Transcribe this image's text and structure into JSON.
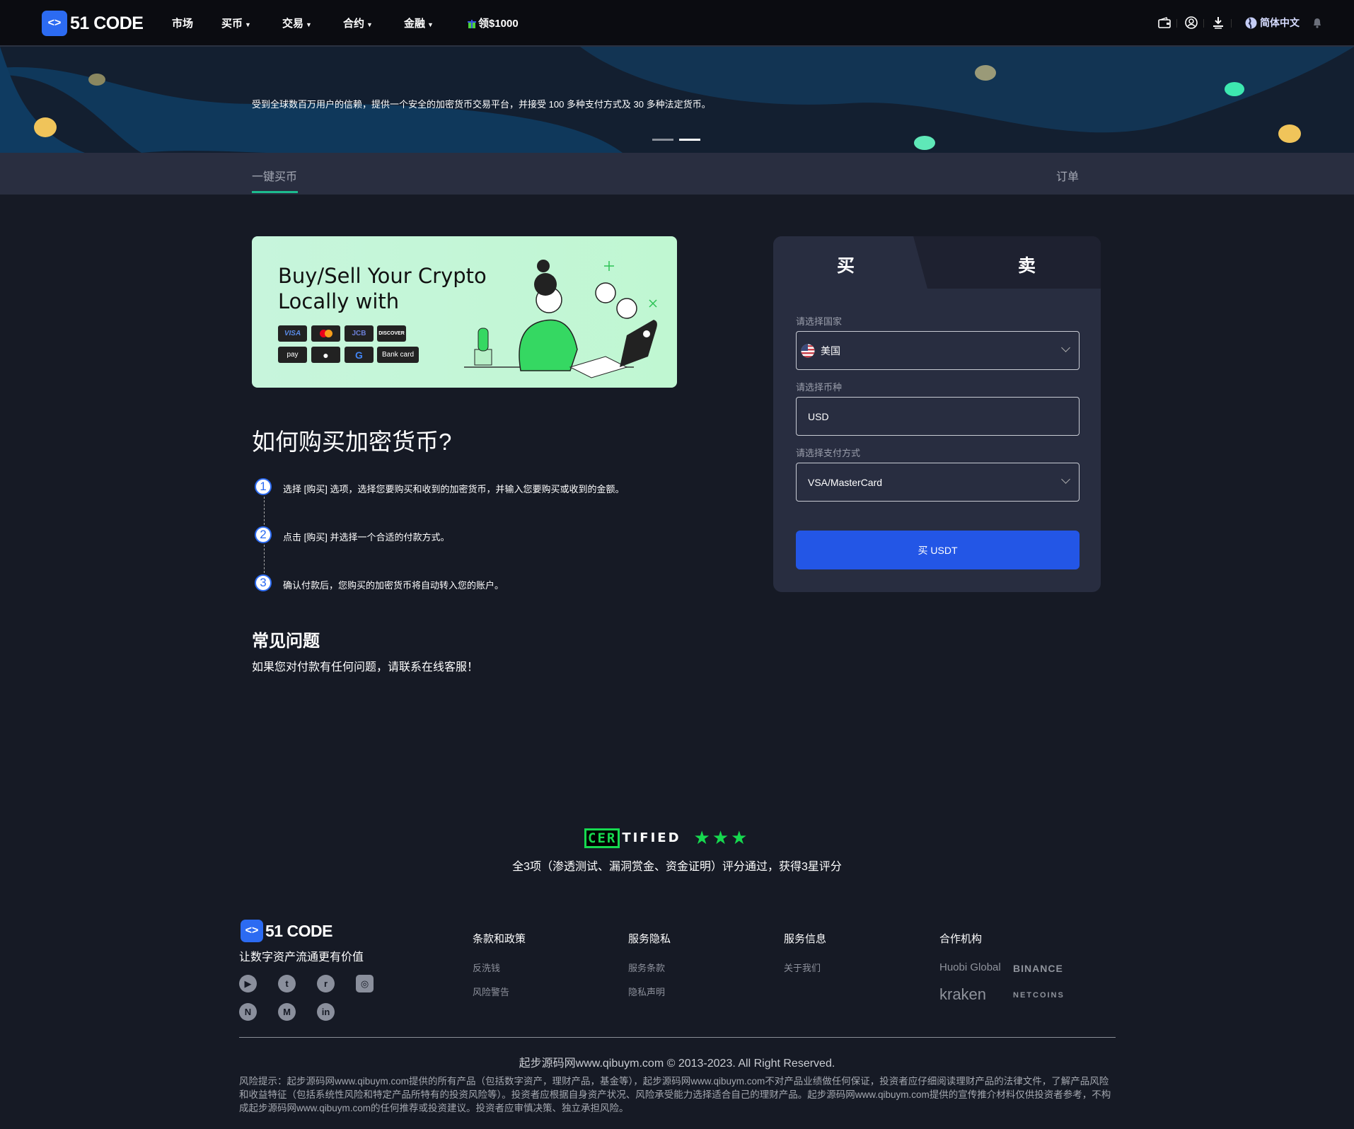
{
  "nav": {
    "logo_mark": "<>",
    "logo_text": "51 CODE",
    "items": [
      {
        "label": "市场"
      },
      {
        "label": "买币",
        "caret": "▼"
      },
      {
        "label": "交易",
        "caret": "▼"
      },
      {
        "label": "合约",
        "caret": "▼"
      },
      {
        "label": "金融",
        "caret": "▼"
      }
    ],
    "promo": "领$1000",
    "language": "简体中文",
    "icons": [
      "wallet-icon",
      "user-icon",
      "download-icon",
      "globe-icon",
      "bell-icon"
    ]
  },
  "banner": {
    "text": "受到全球数百万用户的信赖，提供一个安全的加密货币交易平台，并接受 100 多种支付方式及 30 多种法定货币。",
    "slides": 2,
    "active_slide": 2
  },
  "tabs": {
    "left": "一键买币",
    "right": "订单"
  },
  "promo_card": {
    "title_line1": "Buy/Sell Your Crypto",
    "title_line2": "Locally with",
    "methods": [
      "VISA",
      "MC",
      "JCB",
      "DISCOVER",
      "pay",
      "",
      "G",
      "Bank card"
    ]
  },
  "howto": {
    "title": "如何购买加密货币?",
    "steps": [
      {
        "num": "1",
        "text": "选择 [购买] 选项，选择您要购买和收到的加密货币，并输入您要购买或收到的金额。"
      },
      {
        "num": "2",
        "text": "点击 [购买] 并选择一个合适的付款方式。"
      },
      {
        "num": "3",
        "text": "确认付款后，您购买的加密货币将自动转入您的账户。"
      }
    ]
  },
  "faq": {
    "title": "常见问题",
    "text": "如果您对付款有任何问题，请联系在线客服！"
  },
  "trade": {
    "buy_tab": "买",
    "sell_tab": "卖",
    "country_label": "请选择国家",
    "country_value": "美国",
    "currency_label": "请选择币种",
    "currency_value": "USD",
    "payment_label": "请选择支付方式",
    "payment_value": "VSA/MasterCard",
    "submit": "买 USDT",
    "accent": "#2356e6"
  },
  "certified": {
    "badge_boxed": "CER",
    "badge_rest": "TIFIED",
    "stars": "★★★",
    "text": "全3项（渗透测试、漏洞赏金、资金证明）评分通过，获得3星评分",
    "color": "#16d94f"
  },
  "footer": {
    "logo_text": "51 CODE",
    "slogan": "让数字资产流通更有价值",
    "social": [
      "▶",
      "t",
      "r",
      "◎",
      "N",
      "M",
      "in"
    ],
    "columns": [
      {
        "title": "条款和政策",
        "links": [
          "反洗钱",
          "风险警告"
        ]
      },
      {
        "title": "服务隐私",
        "links": [
          "服务条款",
          "隐私声明"
        ]
      },
      {
        "title": "服务信息",
        "links": [
          "关于我们"
        ]
      }
    ],
    "partners_title": "合作机构",
    "partners": [
      "Huobi Global",
      "BINANCE",
      "kraken",
      "NETCOINS"
    ],
    "copyright": "起步源码网www.qibuym.com © 2013-2023. All Right Reserved.",
    "risk": "风险提示：起步源码网www.qibuym.com提供的所有产品（包括数字资产，理财产品，基金等），起步源码网www.qibuym.com不对产品业绩做任何保证，投资者应仔细阅读理财产品的法律文件，了解产品风险和收益特征（包括系统性风险和特定产品所特有的投资风险等）。投资者应根据自身资产状况、风险承受能力选择适合自己的理财产品。起步源码网www.qibuym.com提供的宣传推介材料仅供投资者参考，不构成起步源码网www.qibuym.com的任何推荐或投资建议。投资者应审慎决策、独立承担风险。"
  }
}
